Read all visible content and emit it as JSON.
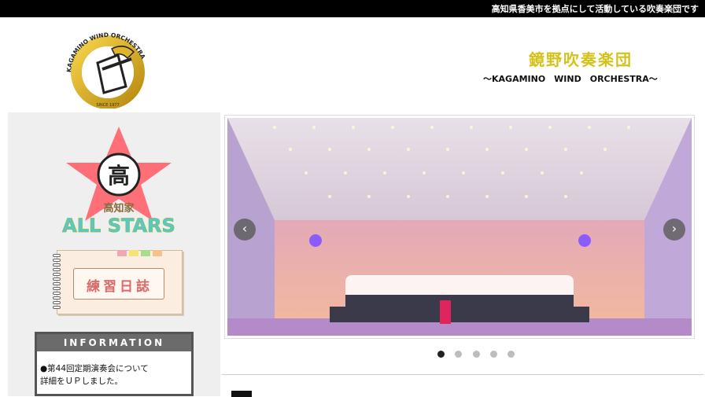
{
  "topbar": {
    "tagline": "高知県香美市を拠点にして活動している吹奏楽団です"
  },
  "header": {
    "title": "鏡野吹奏楽団",
    "subtitle": "～KAGAMINO　WIND　ORCHESTRA～",
    "logo": {
      "ring_text": "KAGAMINO WIND ORCHESTRA",
      "since": "SINCE 1977"
    }
  },
  "sidebar": {
    "allstars_banner": {
      "badge_char": "高",
      "line1": "高知家",
      "line2": "ALL STARS"
    },
    "diary": {
      "label": "練習日誌"
    },
    "information": {
      "title": "INFORMATION",
      "items": [
        "●第44回定期演奏会について",
        "詳細をＵＰしました。"
      ]
    }
  },
  "slider": {
    "prev_icon": "chevron-left-icon",
    "next_icon": "chevron-right-icon",
    "dot_count": 5,
    "active_index": 0
  },
  "colors": {
    "title": "#d4c21a",
    "topbar": "#000000",
    "sidebar_bg": "#efefef",
    "info_header": "#6b6b6b"
  }
}
